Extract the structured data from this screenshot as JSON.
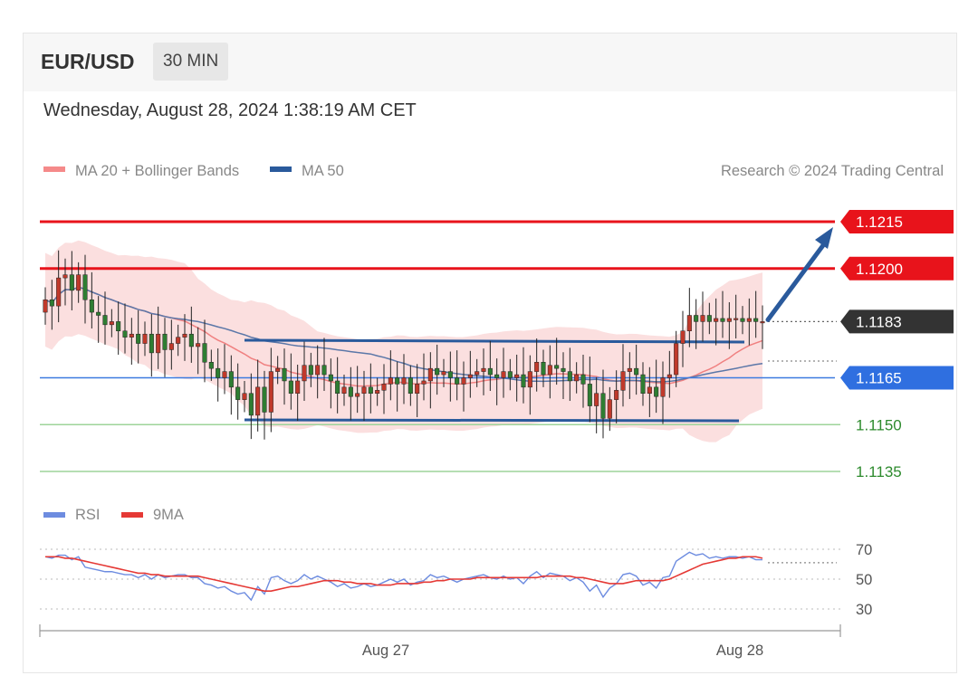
{
  "header": {
    "symbol": "EUR/USD",
    "timeframe": "30 MIN"
  },
  "datetime": "Wednesday, August 28, 2024 1:38:19 AM CET",
  "legend": {
    "bb_label": "MA 20 + Bollinger Bands",
    "ma50_label": "MA 50",
    "credit": "Research © 2024 Trading Central"
  },
  "rsi_legend": {
    "rsi_label": "RSI",
    "ma_label": "9MA"
  },
  "colors": {
    "candle_up": "#c0392b",
    "candle_down": "#2e7d32",
    "resistance": "#e8131b",
    "support_blue": "#1565c0",
    "support_green": "#43a047",
    "bb_fill": "#fbdcdc",
    "ma50": "#5b77a8",
    "rsi": "#6d8ce0",
    "rsi_ma": "#e53935",
    "arrow": "#2a5a9c"
  },
  "chart_data": {
    "type": "candlestick",
    "instrument": "EUR/USD",
    "timeframe": "30 MIN",
    "price_range": [
      1.1128,
      1.1228
    ],
    "x_ticks": [
      "Aug 27",
      "Aug 28"
    ],
    "levels": [
      {
        "value": 1.1215,
        "label": "1.1215",
        "kind": "resistance"
      },
      {
        "value": 1.12,
        "label": "1.1200",
        "kind": "resistance"
      },
      {
        "value": 1.1183,
        "label": "1.1183",
        "kind": "last"
      },
      {
        "value": 1.1165,
        "label": "1.1165",
        "kind": "pivot"
      },
      {
        "value": 1.115,
        "label": "1.1150",
        "kind": "support"
      },
      {
        "value": 1.1135,
        "label": "1.1135",
        "kind": "support"
      }
    ],
    "candles_close": [
      1.119,
      1.1188,
      1.1197,
      1.1198,
      1.1193,
      1.1198,
      1.119,
      1.1186,
      1.1185,
      1.1182,
      1.1183,
      1.118,
      1.1178,
      1.1179,
      1.1176,
      1.1179,
      1.1173,
      1.1179,
      1.1174,
      1.1176,
      1.1178,
      1.1179,
      1.1175,
      1.1176,
      1.117,
      1.1168,
      1.1165,
      1.1167,
      1.1162,
      1.1158,
      1.116,
      1.1153,
      1.1162,
      1.1154,
      1.1167,
      1.1168,
      1.1164,
      1.116,
      1.1164,
      1.1169,
      1.1166,
      1.1169,
      1.1166,
      1.1164,
      1.116,
      1.1162,
      1.1159,
      1.116,
      1.1162,
      1.116,
      1.1161,
      1.1163,
      1.1165,
      1.1163,
      1.1165,
      1.116,
      1.1163,
      1.1164,
      1.1168,
      1.1166,
      1.1167,
      1.1165,
      1.1163,
      1.1165,
      1.1166,
      1.1167,
      1.1168,
      1.1166,
      1.1165,
      1.1167,
      1.1165,
      1.1166,
      1.1162,
      1.1167,
      1.117,
      1.1166,
      1.1169,
      1.1168,
      1.1167,
      1.1164,
      1.1166,
      1.1163,
      1.1156,
      1.116,
      1.1152,
      1.1158,
      1.1161,
      1.1167,
      1.1168,
      1.1166,
      1.116,
      1.1162,
      1.1159,
      1.1165,
      1.1166,
      1.1176,
      1.118,
      1.1185,
      1.1183,
      1.1185,
      1.1183,
      1.1184,
      1.1183,
      1.1184,
      1.1184,
      1.1183,
      1.1184,
      1.1183,
      1.1183
    ],
    "forecast_target": 1.1215,
    "rsi": {
      "y_ticks": [
        70,
        50,
        30
      ],
      "range": [
        22,
        78
      ],
      "rsi_values": [
        65,
        64,
        66,
        66,
        63,
        65,
        58,
        57,
        56,
        55,
        55,
        54,
        53,
        53,
        51,
        53,
        50,
        53,
        51,
        52,
        53,
        53,
        51,
        51,
        47,
        46,
        44,
        45,
        42,
        40,
        41,
        36,
        45,
        40,
        51,
        52,
        49,
        47,
        49,
        53,
        50,
        52,
        50,
        48,
        45,
        47,
        44,
        45,
        47,
        45,
        46,
        48,
        50,
        48,
        50,
        46,
        48,
        49,
        53,
        51,
        52,
        50,
        48,
        50,
        51,
        52,
        53,
        51,
        50,
        52,
        50,
        51,
        47,
        52,
        55,
        51,
        54,
        53,
        52,
        49,
        51,
        48,
        42,
        46,
        38,
        44,
        47,
        53,
        54,
        52,
        46,
        48,
        44,
        51,
        52,
        62,
        65,
        68,
        66,
        67,
        64,
        65,
        64,
        65,
        65,
        64,
        65,
        63,
        63
      ],
      "ma9_values": [
        65,
        65,
        65,
        64,
        64,
        63,
        62,
        61,
        60,
        59,
        58,
        57,
        56,
        55,
        54,
        54,
        53,
        53,
        52,
        52,
        52,
        52,
        52,
        52,
        51,
        50,
        49,
        48,
        47,
        46,
        45,
        44,
        43,
        42,
        42,
        43,
        44,
        45,
        45,
        46,
        47,
        48,
        49,
        49,
        49,
        48,
        48,
        47,
        47,
        47,
        46,
        46,
        46,
        47,
        47,
        47,
        47,
        48,
        48,
        49,
        49,
        50,
        50,
        50,
        50,
        51,
        51,
        51,
        51,
        51,
        51,
        51,
        51,
        51,
        51,
        52,
        52,
        52,
        52,
        52,
        51,
        51,
        50,
        49,
        48,
        47,
        47,
        47,
        48,
        49,
        49,
        49,
        49,
        49,
        50,
        52,
        54,
        56,
        58,
        60,
        61,
        62,
        63,
        64,
        64,
        65,
        65,
        65,
        64
      ]
    }
  }
}
